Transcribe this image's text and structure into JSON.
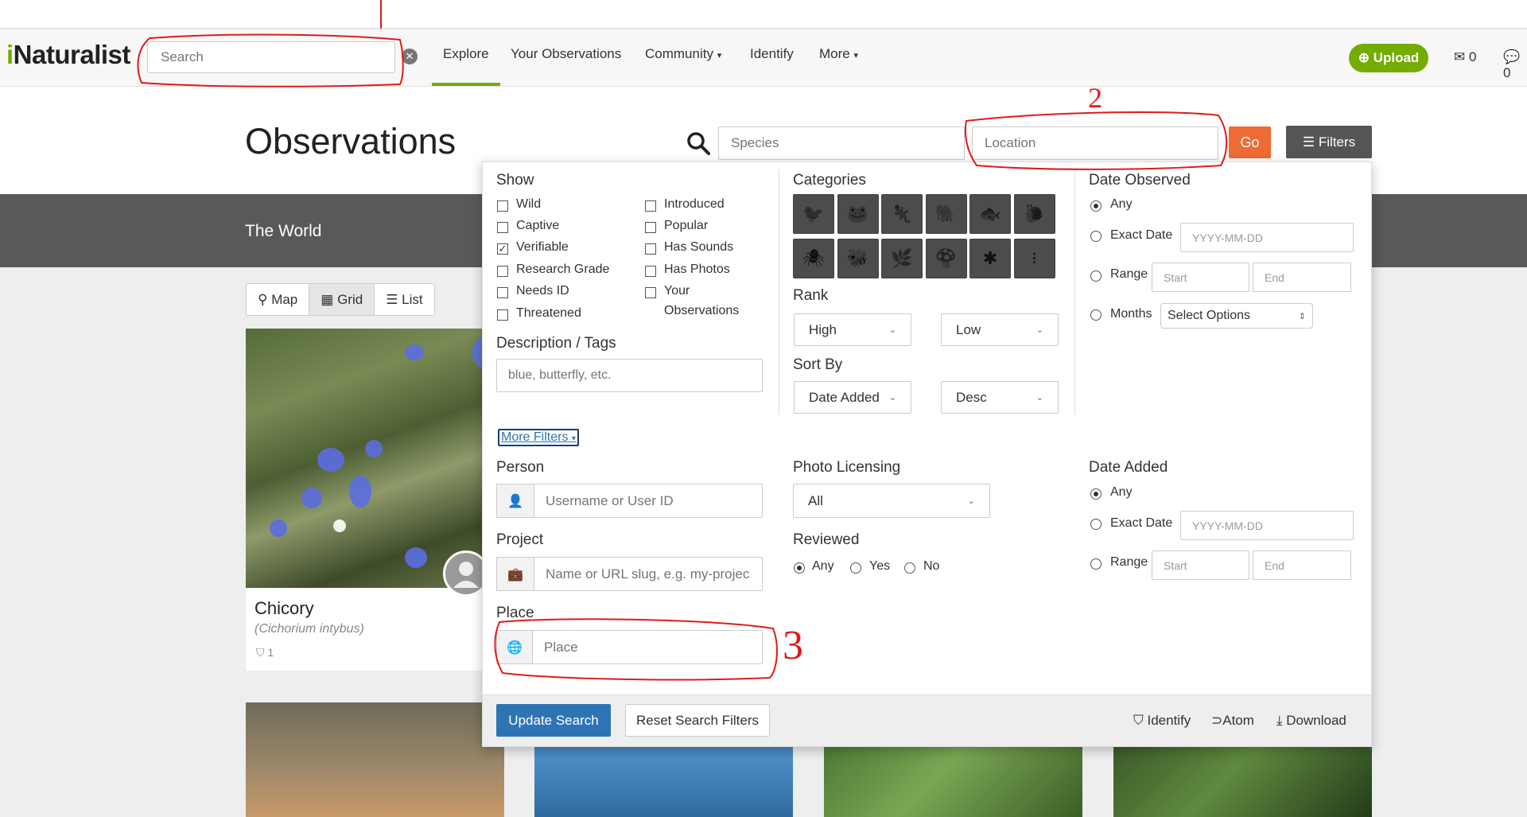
{
  "header": {
    "logo_i": "i",
    "logo_rest": "Naturalist",
    "search_placeholder": "Search",
    "nav": [
      "Explore",
      "Your Observations",
      "Community",
      "Identify",
      "More"
    ],
    "upload_label": "Upload",
    "mail_count": "0",
    "chat_count": "0"
  },
  "page": {
    "title": "Observations",
    "species_placeholder": "Species",
    "location_placeholder": "Location",
    "go_label": "Go",
    "filters_label": "Filters",
    "place_name": "The World",
    "view_modes": [
      "Map",
      "Grid",
      "List"
    ],
    "active_view": "Grid"
  },
  "card": {
    "common_name": "Chicory",
    "scientific_name": "(Cichorium intybus)",
    "id_count": "1"
  },
  "filters": {
    "show_label": "Show",
    "show_left": [
      {
        "label": "Wild",
        "checked": false
      },
      {
        "label": "Captive",
        "checked": false
      },
      {
        "label": "Verifiable",
        "checked": true
      },
      {
        "label": "Research Grade",
        "checked": false
      },
      {
        "label": "Needs ID",
        "checked": false
      },
      {
        "label": "Threatened",
        "checked": false
      }
    ],
    "show_right": [
      {
        "label": "Introduced",
        "checked": false
      },
      {
        "label": "Popular",
        "checked": false
      },
      {
        "label": "Has Sounds",
        "checked": false
      },
      {
        "label": "Has Photos",
        "checked": false
      },
      {
        "label": "Your",
        "checked": false
      }
    ],
    "show_right_wrap": "Observations",
    "categories_label": "Categories",
    "category_icons": [
      "bird-icon",
      "amphibian-icon",
      "reptile-icon",
      "mammal-icon",
      "fish-icon",
      "mollusk-icon",
      "spider-icon",
      "insect-icon",
      "plant-icon",
      "fungi-icon",
      "protozoa-icon",
      "unknown-icon"
    ],
    "rank_label": "Rank",
    "rank_high": "High",
    "rank_low": "Low",
    "sort_label": "Sort By",
    "sort_field": "Date Added",
    "sort_order": "Desc",
    "desc_label": "Description / Tags",
    "desc_placeholder": "blue, butterfly, etc.",
    "date_observed_label": "Date Observed",
    "date_any": "Any",
    "date_exact": "Exact Date",
    "date_placeholder": "YYYY-MM-DD",
    "date_range": "Range",
    "range_start": "Start",
    "range_end": "End",
    "months_label": "Months",
    "months_select": "Select Options",
    "more_filters": "More Filters",
    "person_label": "Person",
    "person_placeholder": "Username or User ID",
    "project_label": "Project",
    "project_placeholder": "Name or URL slug, e.g. my-projec",
    "place_label": "Place",
    "place_placeholder": "Place",
    "licensing_label": "Photo Licensing",
    "licensing_value": "All",
    "reviewed_label": "Reviewed",
    "reviewed_options": [
      "Any",
      "Yes",
      "No"
    ],
    "date_added_label": "Date Added",
    "update_label": "Update Search",
    "reset_label": "Reset Search Filters",
    "identify_link": "Identify",
    "atom_link": "Atom",
    "download_link": "Download"
  },
  "annotations": {
    "marks": [
      "2",
      "3"
    ],
    "color": "#e01b1b"
  },
  "colors": {
    "brand": "#74ac00",
    "go": "#f06a34",
    "update": "#2e74b5",
    "band": "#595959"
  }
}
